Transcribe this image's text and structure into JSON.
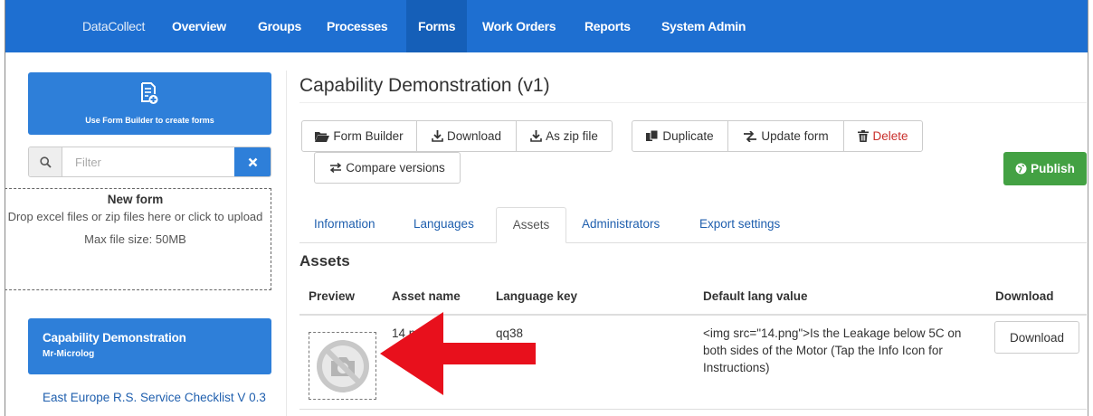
{
  "nav": {
    "brand": "DataCollect",
    "items": [
      "Overview",
      "Groups",
      "Processes",
      "Forms",
      "Work Orders",
      "Reports",
      "System Admin"
    ],
    "active": "Forms"
  },
  "sidebar": {
    "builder_label": "Use Form Builder to create forms",
    "filter_placeholder": "Filter",
    "dropzone": {
      "title": "New form",
      "description": "Drop excel files or zip files here or click to upload",
      "max_size": "Max file size: 50MB"
    },
    "active_form": {
      "title": "Capability Demonstration",
      "subtitle": "Mr-Microlog"
    },
    "next_form": "East Europe R.S. Service Checklist V 0.3"
  },
  "main": {
    "title": "Capability Demonstration (v1)",
    "toolbar": {
      "form_builder": "Form Builder",
      "download": "Download",
      "as_zip": "As zip file",
      "duplicate": "Duplicate",
      "update_form": "Update form",
      "delete": "Delete",
      "compare": "Compare versions",
      "publish": "Publish"
    },
    "tabs": [
      "Information",
      "Languages",
      "Assets",
      "Administrators",
      "Export settings"
    ],
    "active_tab": "Assets",
    "section_title": "Assets",
    "table": {
      "headers": [
        "Preview",
        "Asset name",
        "Language key",
        "Default lang value",
        "Download"
      ],
      "rows": [
        {
          "asset_name": "14.png",
          "language_key": "qq38",
          "default_value": "<img src=\"14.png\">Is the Leakage below 5C on both sides of the Motor (Tap the Info Icon for Instructions)",
          "download_label": "Download"
        }
      ]
    }
  },
  "colors": {
    "navbar": "#1e6fd1",
    "primary": "#2e7fd9",
    "success": "#43a143",
    "danger": "#c9302c",
    "annotation_arrow": "#e8101c"
  }
}
